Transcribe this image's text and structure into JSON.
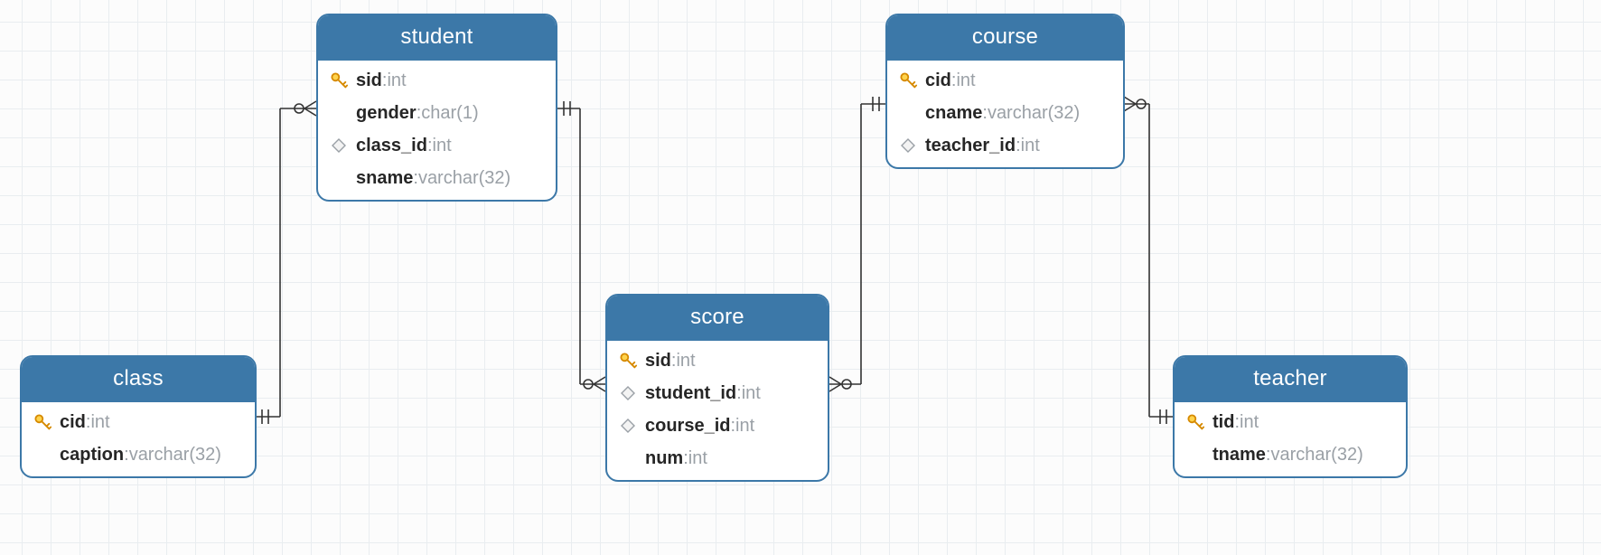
{
  "entities": {
    "student": {
      "title": "student",
      "columns": [
        {
          "icon": "key",
          "name": "sid",
          "type": "int"
        },
        {
          "icon": "none",
          "name": "gender",
          "type": "char(1)"
        },
        {
          "icon": "diamond",
          "name": "class_id",
          "type": "int"
        },
        {
          "icon": "none",
          "name": "sname",
          "type": "varchar(32)"
        }
      ]
    },
    "class": {
      "title": "class",
      "columns": [
        {
          "icon": "key",
          "name": "cid",
          "type": "int"
        },
        {
          "icon": "none",
          "name": "caption",
          "type": "varchar(32)"
        }
      ]
    },
    "score": {
      "title": "score",
      "columns": [
        {
          "icon": "key",
          "name": "sid",
          "type": "int"
        },
        {
          "icon": "diamond",
          "name": "student_id",
          "type": "int"
        },
        {
          "icon": "diamond",
          "name": "course_id",
          "type": "int"
        },
        {
          "icon": "none",
          "name": "num",
          "type": "int"
        }
      ]
    },
    "course": {
      "title": "course",
      "columns": [
        {
          "icon": "key",
          "name": "cid",
          "type": "int"
        },
        {
          "icon": "none",
          "name": "cname",
          "type": "varchar(32)"
        },
        {
          "icon": "diamond",
          "name": "teacher_id",
          "type": "int"
        }
      ]
    },
    "teacher": {
      "title": "teacher",
      "columns": [
        {
          "icon": "key",
          "name": "tid",
          "type": "int"
        },
        {
          "icon": "none",
          "name": "tname",
          "type": "varchar(32)"
        }
      ]
    }
  },
  "relationships": [
    {
      "from": "class",
      "to": "student",
      "from_card": "one",
      "to_card": "many"
    },
    {
      "from": "student",
      "to": "score",
      "from_card": "one",
      "to_card": "many"
    },
    {
      "from": "course",
      "to": "score",
      "from_card": "one",
      "to_card": "many"
    },
    {
      "from": "teacher",
      "to": "course",
      "from_card": "one",
      "to_card": "many"
    }
  ]
}
